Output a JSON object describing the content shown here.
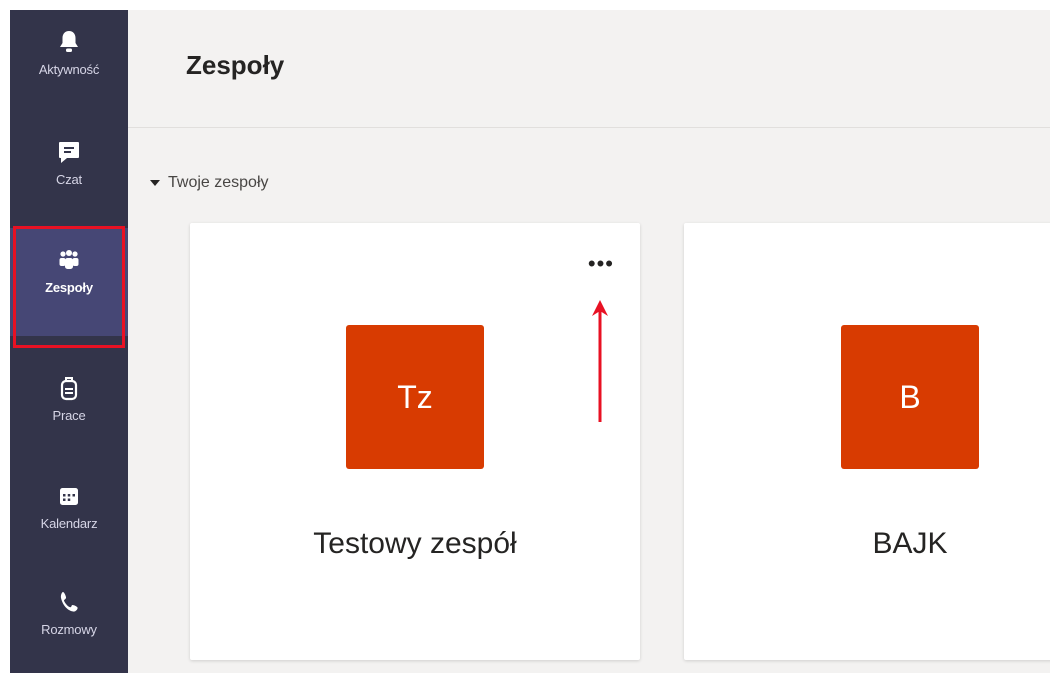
{
  "rail": {
    "items": [
      {
        "label": "Aktywność",
        "icon": "bell-icon"
      },
      {
        "label": "Czat",
        "icon": "chat-icon"
      },
      {
        "label": "Zespoły",
        "icon": "teams-icon",
        "active": true
      },
      {
        "label": "Prace",
        "icon": "backpack-icon"
      },
      {
        "label": "Kalendarz",
        "icon": "calendar-icon"
      },
      {
        "label": "Rozmowy",
        "icon": "phone-icon"
      }
    ]
  },
  "header": {
    "title": "Zespoły"
  },
  "section": {
    "label": "Twoje zespoły"
  },
  "teams": [
    {
      "initials": "Tz",
      "name": "Testowy zespół",
      "more": "•••"
    },
    {
      "initials": "B",
      "name": "BAJK"
    }
  ],
  "colors": {
    "rail_bg": "#33344a",
    "rail_active": "#464775",
    "avatar_bg": "#d83b01",
    "annotation_red": "#e81123",
    "main_bg": "#f3f2f1"
  }
}
